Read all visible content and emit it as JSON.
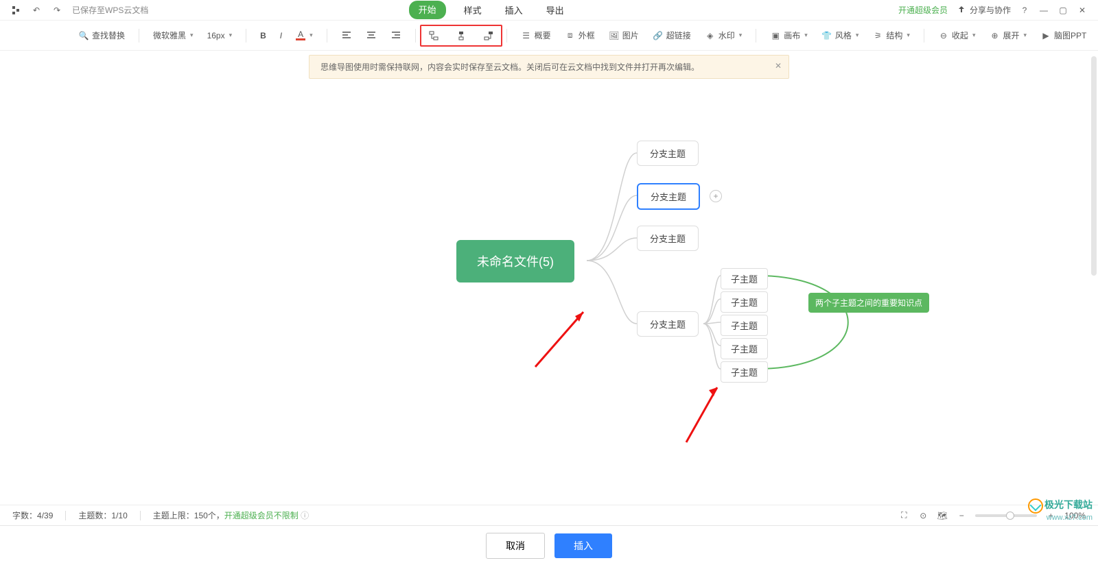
{
  "header": {
    "saved_text": "已保存至WPS云文档",
    "tabs": [
      "开始",
      "样式",
      "插入",
      "导出"
    ],
    "premium": "开通超级会员",
    "share": "分享与协作"
  },
  "ribbon": {
    "find": "查找替换",
    "font_family": "微软雅黑",
    "font_size": "16px",
    "outline": "概要",
    "frame": "外框",
    "image": "图片",
    "link": "超链接",
    "watermark": "水印",
    "canvas": "画布",
    "style": "风格",
    "structure": "结构",
    "collapse": "收起",
    "expand": "展开",
    "mindmap_ppt": "脑图PPT"
  },
  "notice": {
    "text": "思维导图使用时需保持联网，内容会实时保存至云文档。关闭后可在云文档中找到文件并打开再次编辑。"
  },
  "mindmap": {
    "root": "未命名文件(5)",
    "branches": [
      "分支主题",
      "分支主题",
      "分支主题",
      "分支主题"
    ],
    "subs": [
      "子主题",
      "子主题",
      "子主题",
      "子主题",
      "子主题"
    ],
    "annotation": "两个子主题之间的重要知识点"
  },
  "status": {
    "word_count_label": "字数：",
    "word_count": "4/39",
    "topic_count_label": "主题数：",
    "topic_count": "1/10",
    "topic_limit_label": "主题上限：",
    "topic_limit": "150个，",
    "unlimited": "开通超级会员不限制",
    "zoom": "100%"
  },
  "actions": {
    "cancel": "取消",
    "insert": "插入"
  },
  "watermark": {
    "name": "极光下载站",
    "url": "www.xz7.com"
  }
}
